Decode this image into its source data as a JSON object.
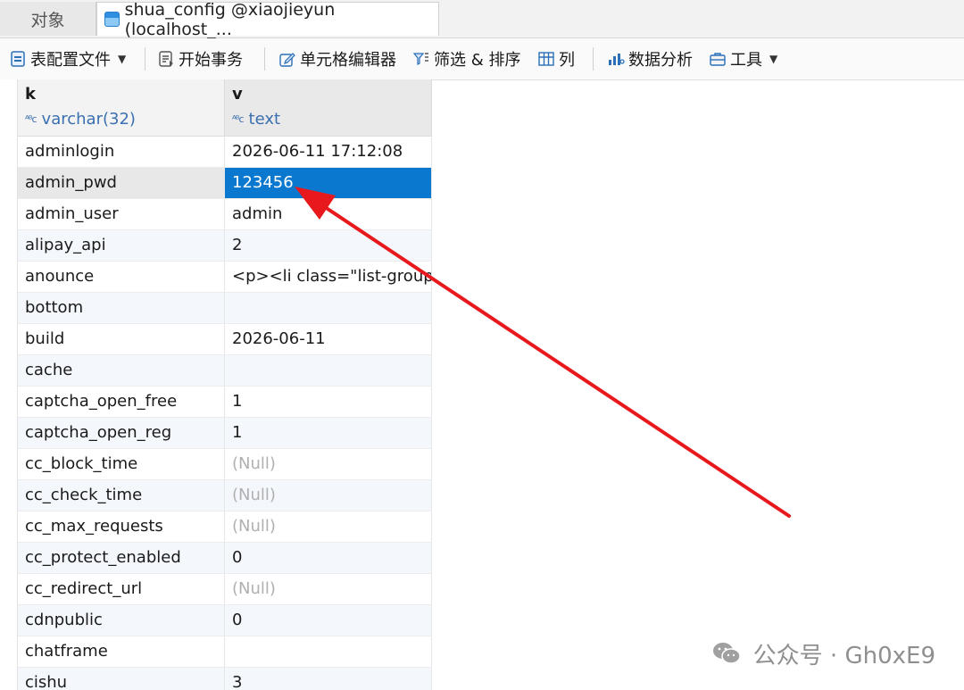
{
  "tabs": {
    "objects": "对象",
    "active": "shua_config @xiaojieyun (localhost_..."
  },
  "toolbar": {
    "table_config": "表配置文件",
    "begin_transaction": "开始事务",
    "cell_editor": "单元格编辑器",
    "filter_sort": "筛选 & 排序",
    "columns": "列",
    "data_analysis": "数据分析",
    "tools": "工具"
  },
  "grid": {
    "columns": [
      {
        "name": "k",
        "type": "varchar(32)"
      },
      {
        "name": "v",
        "type": "text"
      }
    ],
    "rows": [
      {
        "k": "adminlogin",
        "v": "2026-06-11 17:12:08"
      },
      {
        "k": "admin_pwd",
        "v": "123456"
      },
      {
        "k": "admin_user",
        "v": "admin"
      },
      {
        "k": "alipay_api",
        "v": "2"
      },
      {
        "k": "anounce",
        "v": "<p><li class=\"list-group"
      },
      {
        "k": "bottom",
        "v": ""
      },
      {
        "k": "build",
        "v": "2026-06-11"
      },
      {
        "k": "cache",
        "v": ""
      },
      {
        "k": "captcha_open_free",
        "v": "1"
      },
      {
        "k": "captcha_open_reg",
        "v": "1"
      },
      {
        "k": "cc_block_time",
        "v": "(Null)"
      },
      {
        "k": "cc_check_time",
        "v": "(Null)"
      },
      {
        "k": "cc_max_requests",
        "v": "(Null)"
      },
      {
        "k": "cc_protect_enabled",
        "v": "0"
      },
      {
        "k": "cc_redirect_url",
        "v": "(Null)"
      },
      {
        "k": "cdnpublic",
        "v": "0"
      },
      {
        "k": "chatframe",
        "v": ""
      },
      {
        "k": "cishu",
        "v": "3"
      }
    ],
    "selected_row": 1
  },
  "watermark": "公众号 · Gh0xE9",
  "colors": {
    "selection": "#0b78d0",
    "arrow": "#e8191c",
    "null_text": "#b0b0b0"
  }
}
